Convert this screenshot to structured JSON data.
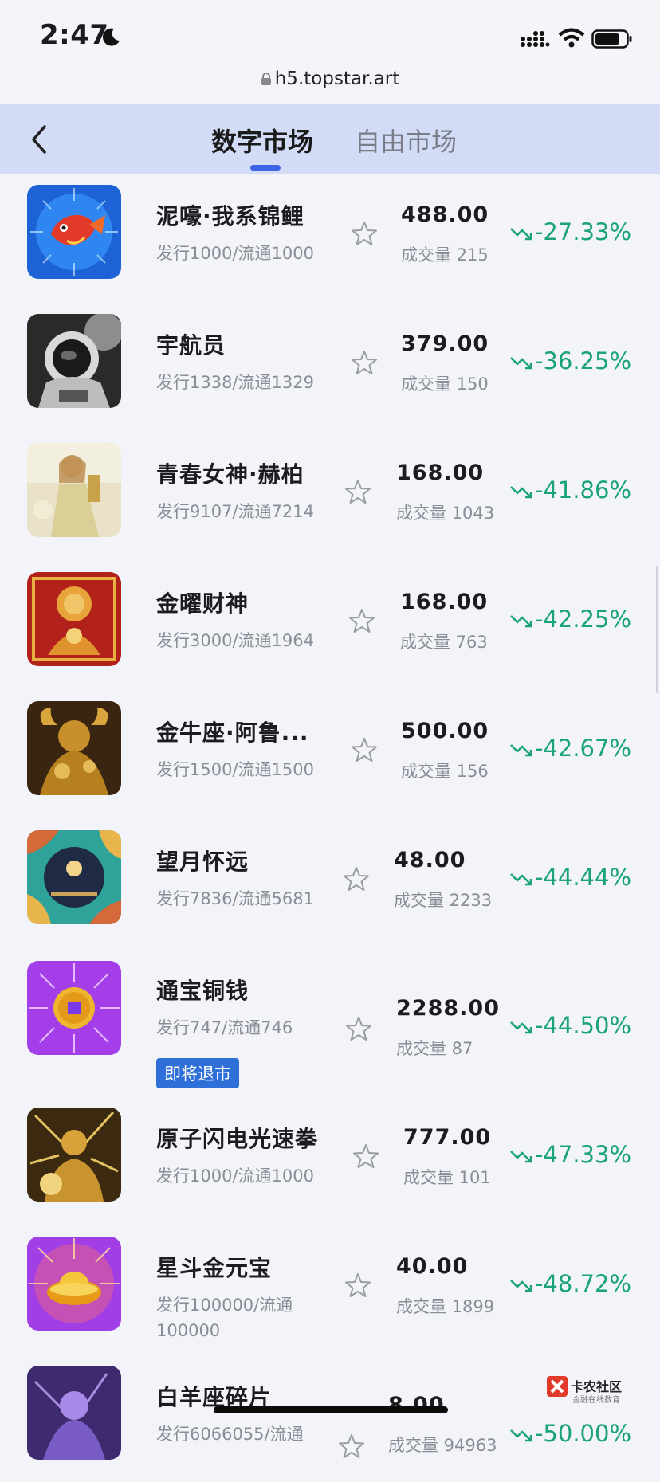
{
  "status": {
    "time": "2:47"
  },
  "browser": {
    "url": "h5.topstar.art"
  },
  "tabs": [
    {
      "label": "数字市场"
    },
    {
      "label": "自由市场"
    }
  ],
  "items": [
    {
      "name": "泥嚎·我系锦鲤",
      "supply": "发行1000/流通1000",
      "price": "488.00",
      "volume": "成交量 215",
      "change": "-27.33%"
    },
    {
      "name": "宇航员",
      "supply": "发行1338/流通1329",
      "price": "379.00",
      "volume": "成交量 150",
      "change": "-36.25%"
    },
    {
      "name": "青春女神·赫柏",
      "supply": "发行9107/流通7214",
      "price": "168.00",
      "volume": "成交量 1043",
      "change": "-41.86%"
    },
    {
      "name": "金曜财神",
      "supply": "发行3000/流通1964",
      "price": "168.00",
      "volume": "成交量 763",
      "change": "-42.25%"
    },
    {
      "name": "金牛座·阿鲁...",
      "supply": "发行1500/流通1500",
      "price": "500.00",
      "volume": "成交量 156",
      "change": "-42.67%"
    },
    {
      "name": "望月怀远",
      "supply": "发行7836/流通5681",
      "price": "48.00",
      "volume": "成交量 2233",
      "change": "-44.44%"
    },
    {
      "name": "通宝铜钱",
      "supply": "发行747/流通746",
      "price": "2288.00",
      "volume": "成交量 87",
      "change": "-44.50%",
      "badge": "即将退市"
    },
    {
      "name": "原子闪电光速拳",
      "supply": "发行1000/流通1000",
      "price": "777.00",
      "volume": "成交量 101",
      "change": "-47.33%"
    },
    {
      "name": "星斗金元宝",
      "supply": "发行100000/流通100000",
      "price": "40.00",
      "volume": "成交量 1899",
      "change": "-48.72%"
    },
    {
      "name": "白羊座碎片",
      "supply": "发行6066055/流通",
      "price": "8.00",
      "volume": "成交量 94963",
      "change": "-50.00%"
    }
  ],
  "watermark": {
    "name": "卡农社区",
    "tagline": "金融在线教育"
  },
  "colors": {
    "header_bg": "#d2dcf6",
    "accent": "#3d63e6",
    "down": "#1aa374",
    "badge": "#2f6fd8"
  }
}
